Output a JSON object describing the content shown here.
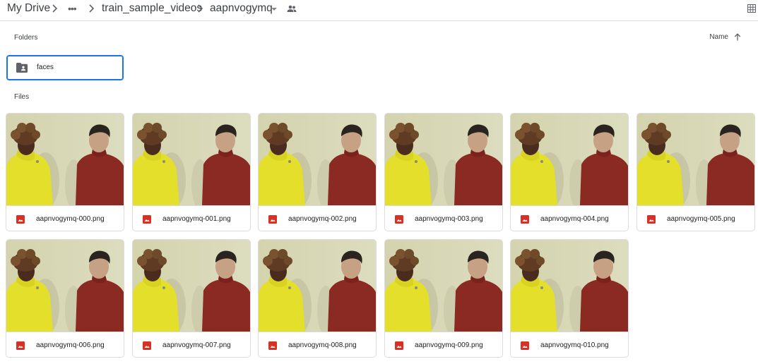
{
  "breadcrumb": {
    "root": "My Drive",
    "more": "•••",
    "parent": "train_sample_videos",
    "current": "aapnvogymq"
  },
  "folders_label": "Folders",
  "files_label": "Files",
  "sort": {
    "label": "Name",
    "direction_icon": "arrow-up-icon"
  },
  "folders": [
    {
      "name": "faces",
      "icon": "shared-folder-icon"
    }
  ],
  "files": [
    {
      "name": "aapnvogymq-000.png"
    },
    {
      "name": "aapnvogymq-001.png"
    },
    {
      "name": "aapnvogymq-002.png"
    },
    {
      "name": "aapnvogymq-003.png"
    },
    {
      "name": "aapnvogymq-004.png"
    },
    {
      "name": "aapnvogymq-005.png"
    },
    {
      "name": "aapnvogymq-006.png"
    },
    {
      "name": "aapnvogymq-007.png"
    },
    {
      "name": "aapnvogymq-008.png"
    },
    {
      "name": "aapnvogymq-009.png"
    },
    {
      "name": "aapnvogymq-010.png"
    }
  ],
  "colors": {
    "accent": "#1a73e8",
    "image_icon": "#d93025",
    "wall": "#d9d8b6",
    "yellow_top": "#e6e028",
    "red_top": "#8b2a22"
  }
}
